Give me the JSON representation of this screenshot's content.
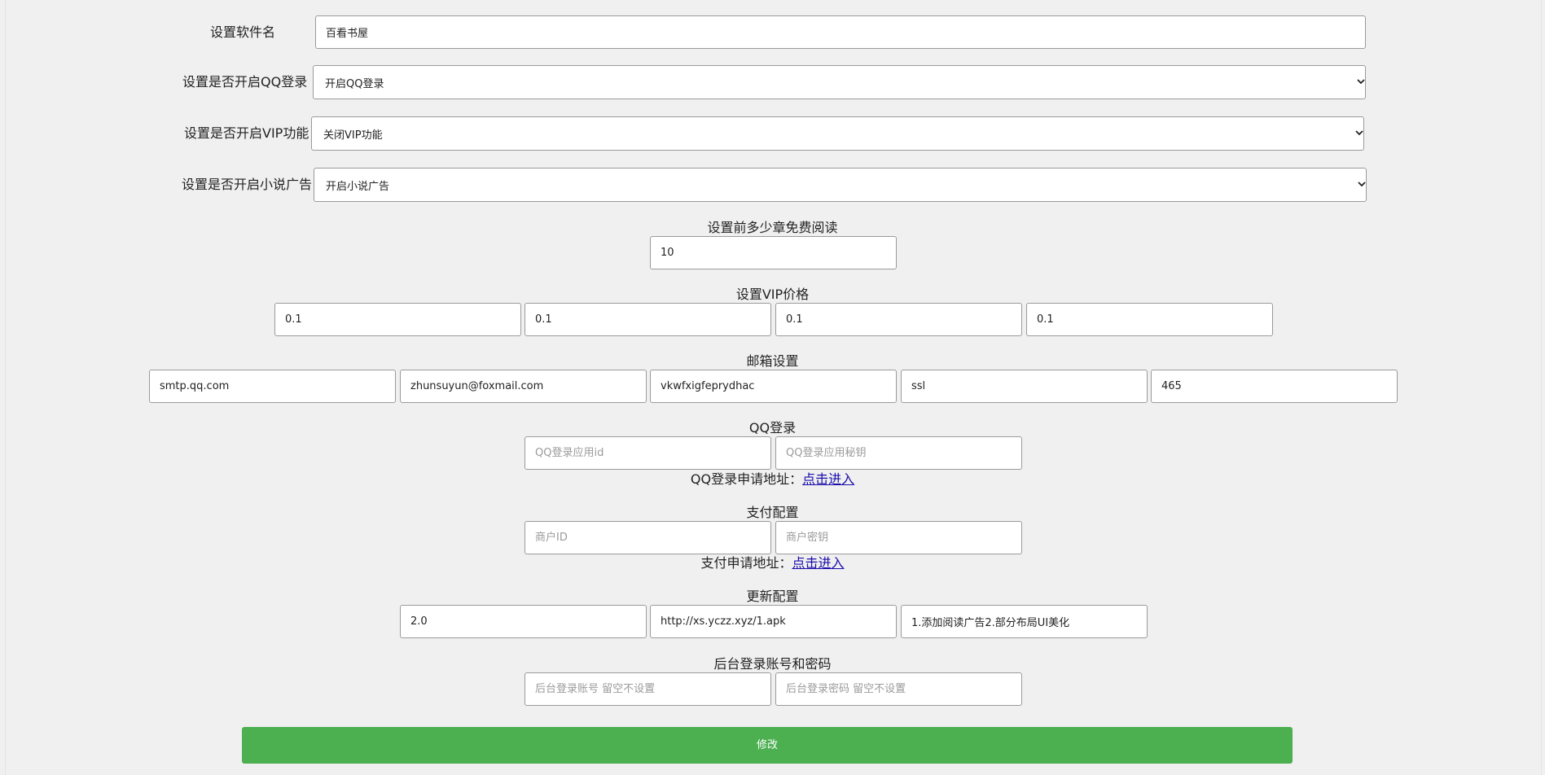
{
  "software_name": {
    "label": "设置软件名",
    "value": "百看书屋"
  },
  "qq_login_toggle": {
    "label": "设置是否开启QQ登录",
    "selected": "开启QQ登录"
  },
  "vip_toggle": {
    "label": "设置是否开启VIP功能",
    "selected": "关闭VIP功能"
  },
  "ad_toggle": {
    "label": "设置是否开启小说广告",
    "selected": "开启小说广告"
  },
  "free_chapters": {
    "label": "设置前多少章免费阅读",
    "value": "10"
  },
  "vip_price": {
    "label": "设置VIP价格",
    "values": [
      "0.1",
      "0.1",
      "0.1",
      "0.1"
    ]
  },
  "email": {
    "label": "邮箱设置",
    "values": [
      "smtp.qq.com",
      "zhunsuyun@foxmail.com",
      "vkwfxigfeprydhac",
      "ssl",
      "465"
    ]
  },
  "qq_login": {
    "label": "QQ登录",
    "app_id_placeholder": "QQ登录应用id",
    "app_key_placeholder": "QQ登录应用秘钥",
    "apply_text": "QQ登录申请地址：",
    "apply_link": "点击进入"
  },
  "payment": {
    "label": "支付配置",
    "merchant_id_placeholder": "商户ID",
    "merchant_key_placeholder": "商户密钥",
    "apply_text": "支付申请地址：",
    "apply_link": "点击进入"
  },
  "update": {
    "label": "更新配置",
    "values": [
      "2.0",
      "http://xs.yczz.xyz/1.apk",
      "1.添加阅读广告2.部分布局UI美化"
    ]
  },
  "admin": {
    "label": "后台登录账号和密码",
    "account_placeholder": "后台登录账号 留空不设置",
    "password_placeholder": "后台登录密码 留空不设置"
  },
  "submit_label": "修改",
  "colors": {
    "button": "#4caf50",
    "link": "#1a0dab",
    "background": "#f0f0f0"
  }
}
